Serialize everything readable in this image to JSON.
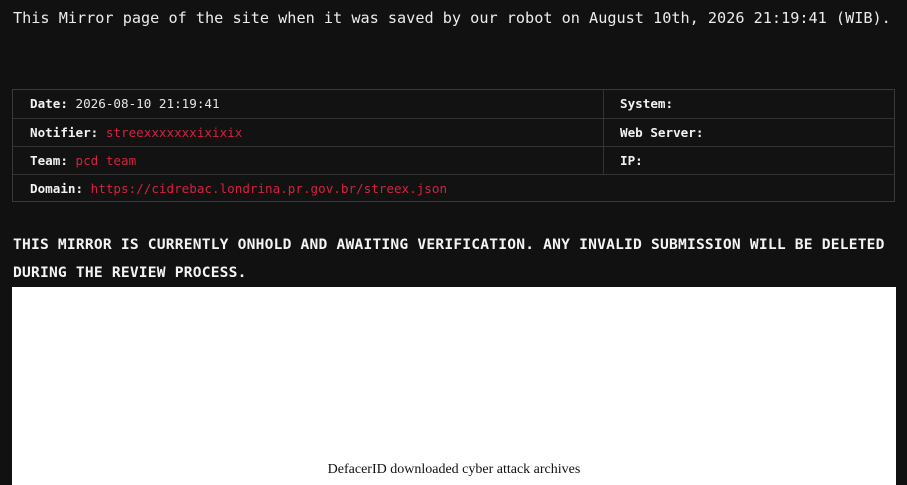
{
  "intro_text": "This Mirror page of the site when it was saved by our robot on August 10th, 2026 21:19:41 (WIB).",
  "info": {
    "date_label": "Date:",
    "date_value": "2026-08-10 21:19:41",
    "notifier_label": "Notifier:",
    "notifier_value": "streexxxxxxxixixix",
    "team_label": "Team:",
    "team_value": "pcd team",
    "domain_label": "Domain:",
    "domain_value": "https://cidrebac.londrina.pr.gov.br/streex.json",
    "system_label": "System:",
    "system_value": "",
    "webserver_label": "Web Server:",
    "webserver_value": "",
    "ip_label": "IP:",
    "ip_value": ""
  },
  "notice_text": "THIS MIRROR IS CURRENTLY ONHOLD AND AWAITING VERIFICATION. ANY INVALID SUBMISSION WILL BE DELETED DURING THE REVIEW PROCESS.",
  "mirror_frame": {
    "caption": "DefacerID downloaded cyber attack archives"
  },
  "colors": {
    "background": "#111111",
    "link_red": "#d3223e",
    "text": "#ececec",
    "border": "#333333"
  }
}
